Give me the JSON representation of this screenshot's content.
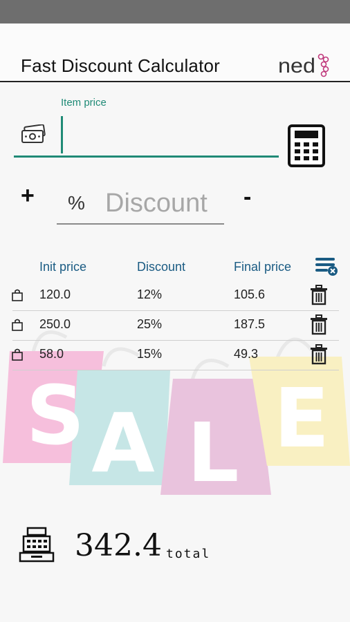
{
  "app": {
    "title": "Fast Discount Calculator",
    "logo_text": "ned",
    "accent_color": "#1f8a76",
    "header_color": "#1a5b83"
  },
  "price_field": {
    "label": "Item price",
    "value": "",
    "icon": "money-bill-icon"
  },
  "discount": {
    "plus_label": "+",
    "minus_label": "-",
    "percent_symbol": "%",
    "placeholder": "Discount"
  },
  "table": {
    "headers": [
      "Init price",
      "Discount",
      "Final price"
    ],
    "rows": [
      {
        "init_price": "120.0",
        "discount": "12%",
        "final_price": "105.6"
      },
      {
        "init_price": "250.0",
        "discount": "25%",
        "final_price": "187.5"
      },
      {
        "init_price": "58.0",
        "discount": "15%",
        "final_price": "49.3"
      }
    ]
  },
  "sale_banner": {
    "letters": [
      "S",
      "A",
      "L",
      "E"
    ],
    "bag_colors": [
      "#f6bfdc",
      "#bfe3e4",
      "#e8bfdc",
      "#f9f0c0"
    ]
  },
  "total": {
    "value": "342.4",
    "label": "total"
  }
}
